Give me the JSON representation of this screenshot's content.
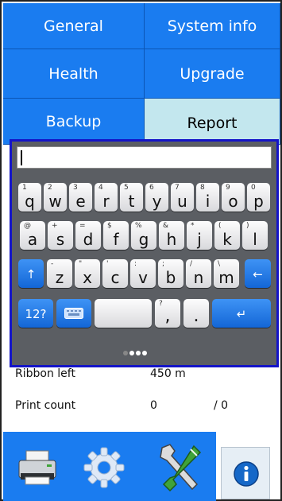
{
  "menu": {
    "general": "General",
    "system_info": "System info",
    "health": "Health",
    "upgrade": "Upgrade",
    "backup": "Backup",
    "report": "Report"
  },
  "keyboard": {
    "input_value": "",
    "row1": [
      {
        "hint": "1",
        "key": "q"
      },
      {
        "hint": "2",
        "key": "w"
      },
      {
        "hint": "3",
        "key": "e"
      },
      {
        "hint": "4",
        "key": "r"
      },
      {
        "hint": "5",
        "key": "t"
      },
      {
        "hint": "6",
        "key": "y"
      },
      {
        "hint": "7",
        "key": "u"
      },
      {
        "hint": "8",
        "key": "i"
      },
      {
        "hint": "9",
        "key": "o"
      },
      {
        "hint": "0",
        "key": "p"
      }
    ],
    "row2": [
      {
        "hint": "@",
        "key": "a"
      },
      {
        "hint": "+",
        "key": "s"
      },
      {
        "hint": "=",
        "key": "d"
      },
      {
        "hint": "$",
        "key": "f"
      },
      {
        "hint": "%",
        "key": "g"
      },
      {
        "hint": "&",
        "key": "h"
      },
      {
        "hint": "*",
        "key": "j"
      },
      {
        "hint": "(",
        "key": "k"
      },
      {
        "hint": ")",
        "key": "l"
      }
    ],
    "row3": [
      {
        "hint": "-",
        "key": "z"
      },
      {
        "hint": "\"",
        "key": "x"
      },
      {
        "hint": "'",
        "key": "c"
      },
      {
        "hint": ":",
        "key": "v"
      },
      {
        "hint": ";",
        "key": "b"
      },
      {
        "hint": "/",
        "key": "n"
      },
      {
        "hint": "\\",
        "key": "m"
      }
    ],
    "shift_symbol": "↑",
    "backspace_symbol": "←",
    "numbers_label": "12?",
    "question_hint": "?",
    "comma": ",",
    "period": ".",
    "enter_symbol": "↵",
    "page_count": 4
  },
  "status": {
    "ribbon_label": "Ribbon left",
    "ribbon_value": "450 m",
    "print_label": "Print count",
    "print_value": "0",
    "print_total": "/ 0"
  },
  "toolbar": {
    "icons": [
      "printer-icon",
      "gear-icon",
      "tools-icon",
      "info-icon"
    ]
  },
  "colors": {
    "menu_blue": "#1a7cf0",
    "menu_active": "#c3e7ee",
    "keyboard_border": "#1414c8",
    "keyboard_bg": "#5b5e63"
  }
}
